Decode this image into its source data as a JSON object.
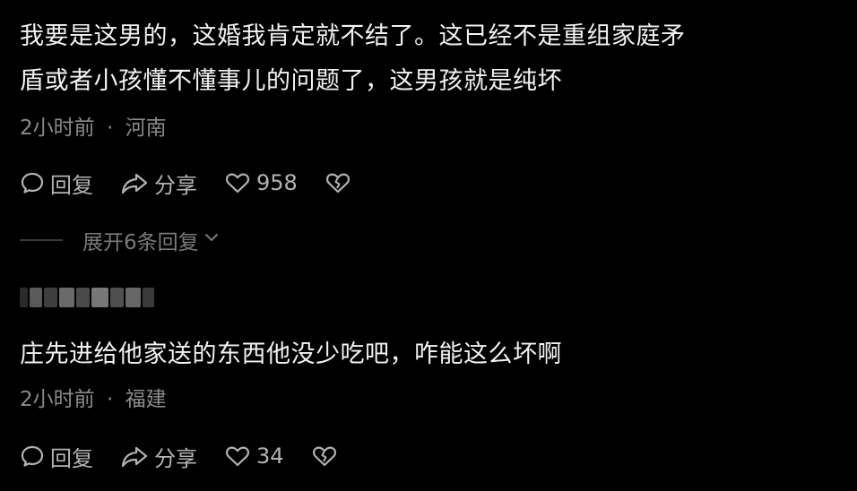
{
  "comments": [
    {
      "text_line1": "我要是这男的，这婚我肯定就不结了。这已经不是重组家庭矛",
      "text_line2": "盾或者小孩懂不懂事儿的问题了，这男孩就是纯坏",
      "time": "2小时前",
      "separator": "·",
      "location": "河南",
      "reply_label": "回复",
      "share_label": "分享",
      "like_count": "958",
      "expand_label": "展开6条回复"
    },
    {
      "text_line1": "庄先进给他家送的东西他没少吃吧，咋能这么坏啊",
      "time": "2小时前",
      "separator": "·",
      "location": "福建",
      "reply_label": "回复",
      "share_label": "分享",
      "like_count": "34"
    }
  ],
  "icons": {
    "reply": "chat-bubble-icon",
    "share": "share-arrow-icon",
    "like": "heart-outline-icon",
    "dislike": "broken-heart-icon",
    "expand": "chevron-down-icon"
  },
  "colors": {
    "background": "#000000",
    "text": "#f2f2f2",
    "meta": "#8a8a8a",
    "icon": "#b3b3b3"
  }
}
